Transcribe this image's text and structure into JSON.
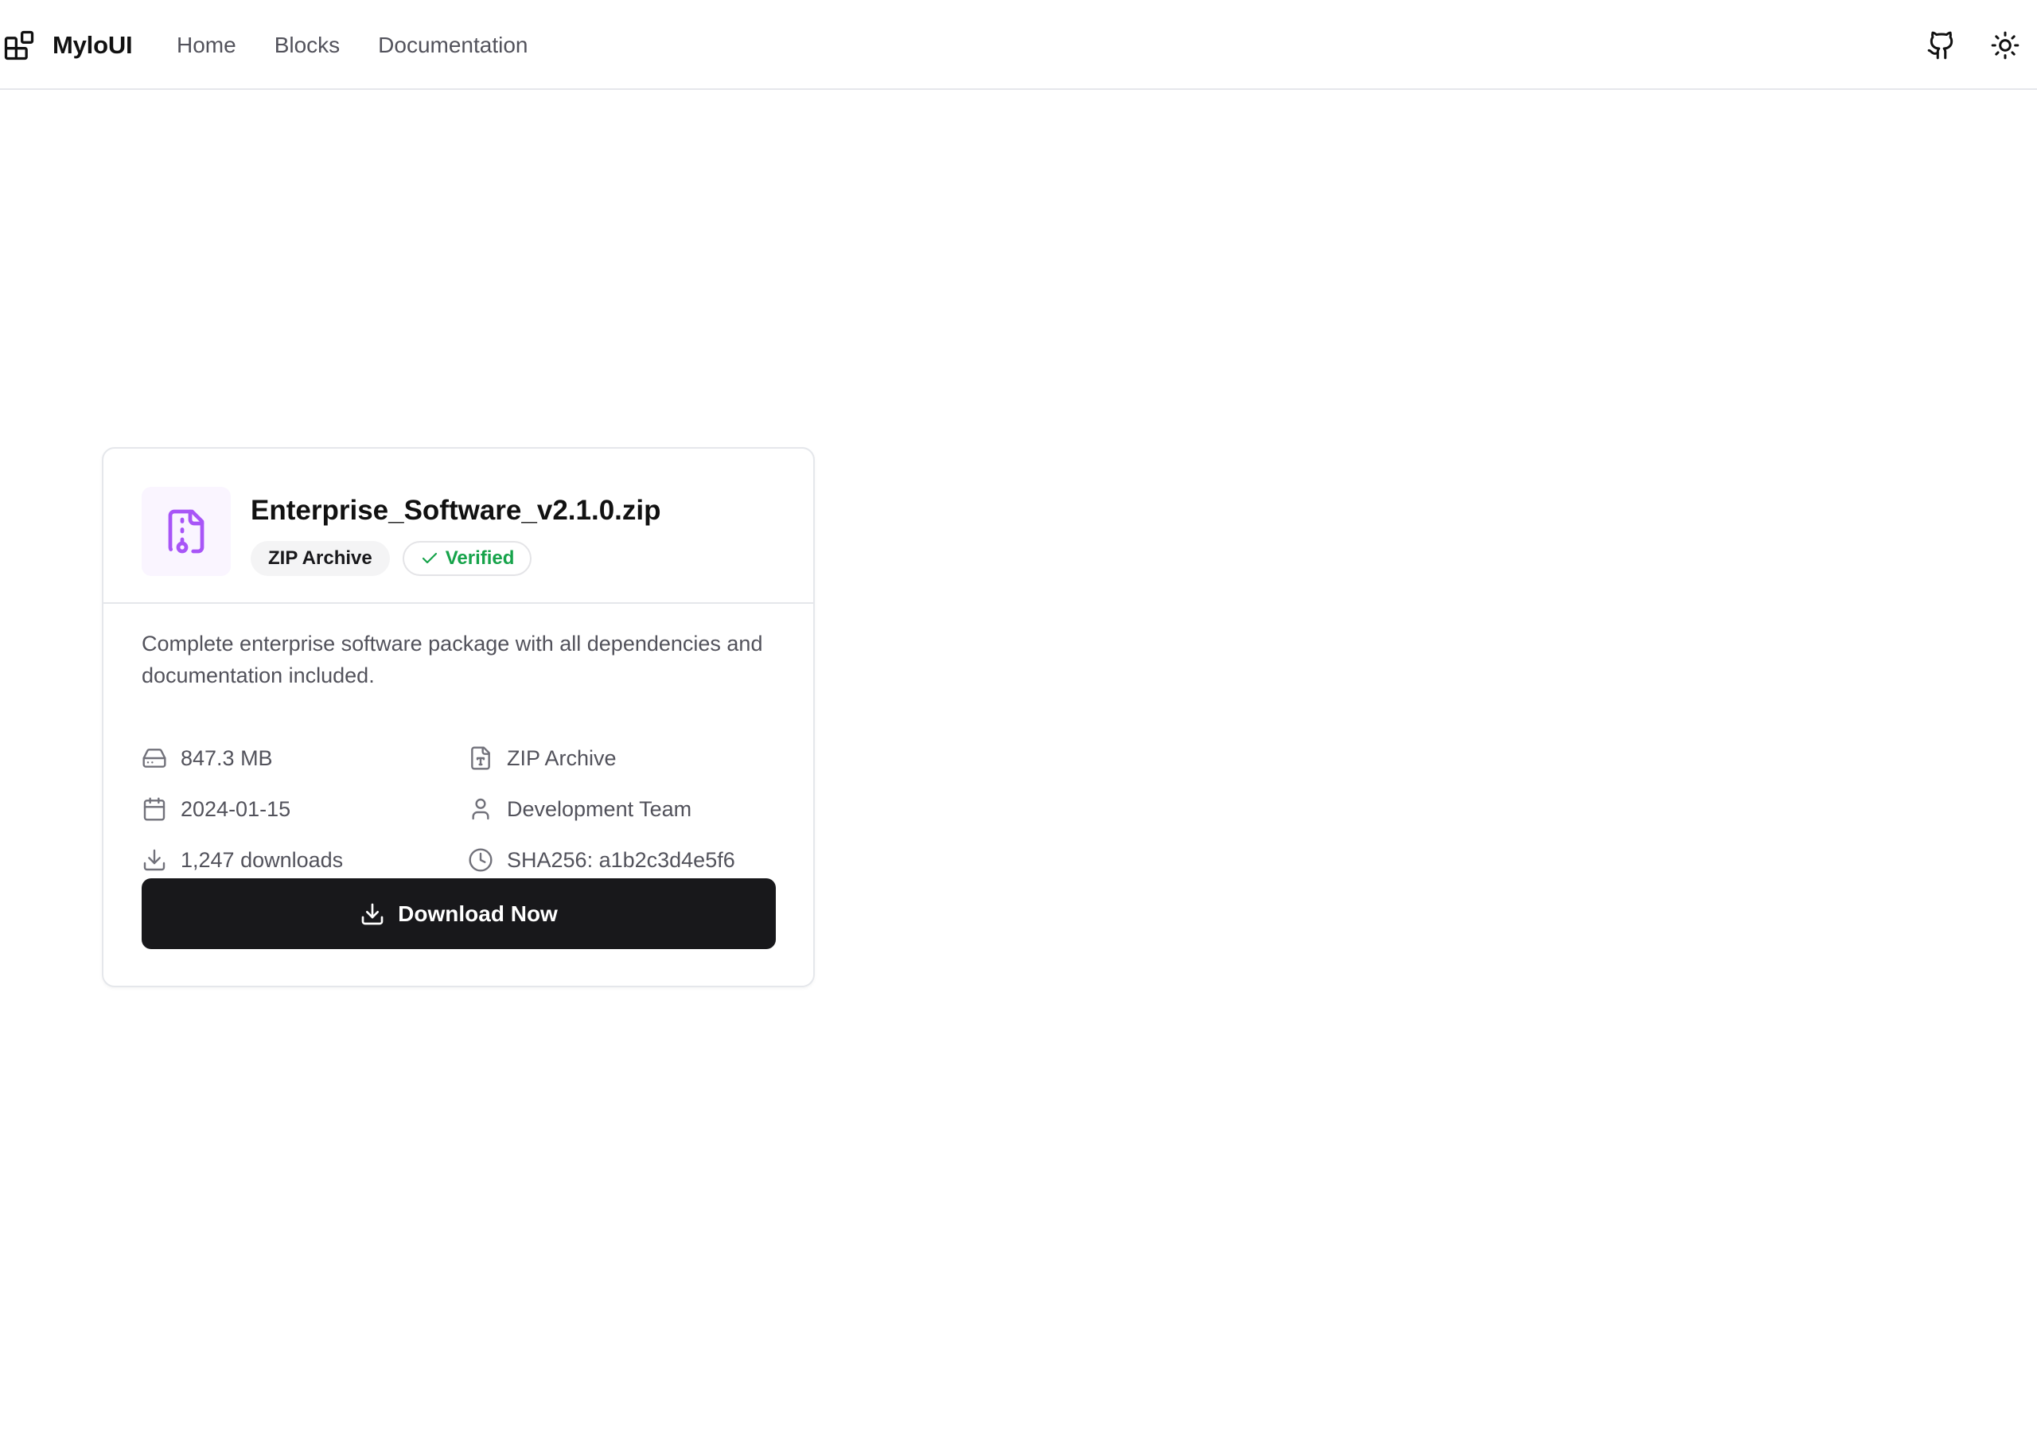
{
  "brand": {
    "name": "MyloUI",
    "icon": "blocks-icon"
  },
  "nav": {
    "items": [
      {
        "label": "Home"
      },
      {
        "label": "Blocks"
      },
      {
        "label": "Documentation"
      }
    ]
  },
  "top_actions": {
    "github_icon": "github-icon",
    "theme_icon": "sun-icon"
  },
  "file_card": {
    "file_icon": "file-archive-icon",
    "file_name": "Enterprise_Software_v2.1.0.zip",
    "type_badge": "ZIP Archive",
    "verified_badge": "Verified",
    "description": "Complete enterprise software package with all dependencies and documentation included.",
    "meta": {
      "size": "847.3 MB",
      "type": "ZIP Archive",
      "date": "2024-01-15",
      "author": "Development Team",
      "downloads": "1,247 downloads",
      "checksum": "SHA256: a1b2c3d4e5f6"
    },
    "download_label": "Download Now"
  },
  "colors": {
    "accent_purple": "#a855f7",
    "icon_bg": "#faf5ff",
    "verified_green": "#16a34a",
    "button_bg": "#18181b",
    "border": "#e5e7eb",
    "muted_text": "#52525b"
  }
}
